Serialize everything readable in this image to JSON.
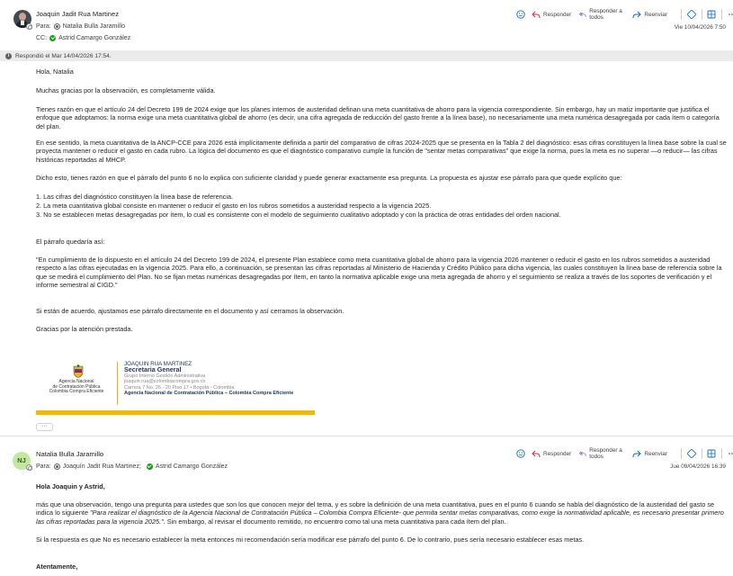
{
  "message1": {
    "sender": "Joaquin Jadit Rua Martinez",
    "to_label": "Para:",
    "to": "Natalia Bulla Jaramillo",
    "cc_label": "CC:",
    "cc": "Astrid Camargo González",
    "date": "Vie 10/04/2026 7:50",
    "toolbar": {
      "reply": "Responder",
      "reply_all": "Responder a todos",
      "forward": "Reenviar"
    },
    "replied_notice": "Respondió el Mar 14/04/2026 17:54.",
    "greeting": "Hola, Natalia",
    "p1": "Muchas gracias por la observación, es completamente válida.",
    "p2": "Tienes razón en que el artículo 24 del Decreto 199 de 2024 exige que los planes internos de austeridad definan una meta cuantitativa de ahorro para la vigencia correspondiente. Sin embargo, hay un matiz importante que justifica el enfoque que adoptamos: la norma exige una meta cuantitativa global de ahorro (es decir, una cifra agregada de reducción del gasto frente a la línea base), no necesariamente una meta numérica desagregada por cada ítem o categoría del plan.",
    "p3": "En ese sentido, la meta cuantitativa de la ANCP-CCE para 2026 está implícitamente definida a partir del comparativo de cifras 2024-2025 que se presenta en la Tabla 2 del diagnóstico: esas cifras constituyen la línea base sobre la cual se proyecta mantener o reducir el gasto en cada rubro. La lógica del documento es que el diagnóstico comparativo cumple la función de \"sentar metas comparativas\" que exige la norma, pues la meta es no superar —o reducir— las cifras históricas reportadas al MHCP.",
    "p4": "Dicho esto, tienes razón en que el párrafo del punto 6 no lo explica con suficiente claridad y puede generar exactamente esa pregunta. La propuesta es ajustar ese párrafo para que quede explícito que:",
    "list": [
      "1. Las cifras del diagnóstico constituyen la línea base de referencia.",
      "2. La meta cuantitativa global consiste en mantener o reducir el gasto en los rubros sometidos a austeridad respecto a la vigencia 2025.",
      "3. No se establecen metas desagregadas por ítem, lo cual es consistente con el modelo de seguimiento cualitativo adoptado y con la práctica de otras entidades del orden nacional."
    ],
    "p5": "El párrafo quedaría así:",
    "p6": "\"En cumplimiento de lo dispuesto en el artículo 24 del Decreto 199 de 2024, el presente Plan establece como meta cuantitativa global de ahorro para la vigencia 2026 mantener o reducir el gasto en los rubros sometidos a austeridad respecto a las cifras ejecutadas en la vigencia 2025. Para ello, a continuación, se presentan las cifras reportadas al Ministerio de Hacienda y Crédito Público para dicha vigencia, las cuales constituyen la línea base de referencia sobre la que se medirá el cumplimiento del Plan. No se fijan metas numéricas desagregadas por ítem, en tanto la normativa aplicable exige una meta agregada de ahorro y el seguimiento se realiza a través de los soportes de verificación y el informe semestral al CIGD.\"",
    "p7": "Si están de acuerdo, ajustamos ese párrafo directamente en el documento y así cerramos la observación.",
    "p8": "Gracias por la atención prestada.",
    "signature": {
      "org_line1": "Agencia Nacional",
      "org_line2": "de Contratación Pública",
      "org_line3": "Colombia Compra Eficiente",
      "name": "JOAQUIN RUA MARTINEZ",
      "role": "Secretaria General",
      "group": "Grupo Interno Gestión Administrativa",
      "email": "joaquin.rua@colombiacompra.gov.co",
      "address": "Carrera 7 No. 26 - 20 Piso 17 • Bogotá - Colombia",
      "agency": "Agencia Nacional de Contratación Pública – Colombia Compra Eficiente"
    },
    "more_button": "···"
  },
  "message2": {
    "initials": "NJ",
    "sender": "Natalia Bulla Jaramillo",
    "to_label": "Para:",
    "to1": "Joaquín Jadit Rua Martinez;",
    "to2": "Astrid Camargo González",
    "date": "Jue 09/04/2026 16:39",
    "toolbar": {
      "reply": "Responder",
      "reply_all": "Responder a todos",
      "forward": "Reenviar"
    },
    "greeting": "Hola Joaquin y Astrid,",
    "p1_a": "más que una observación, tengo una pregunta para ustedes que son los que conocen mejor del tema, y es sobre la definición de una meta cuantitativa,  pues en el punto 6 cuando se habla del diagnóstico de la austeridad del gasto se indica lo siguiente ",
    "p1_italic": "\"Para realizar el diagnóstico de la Agencia Nacional de Contratación Pública – Colombia Compra Eficiente- que permita sentar metas comparativas, como exige la normatividad aplicable, es necesario presentar primero las cifras reportadas para la vigencia 2025.\"",
    "p1_b": ".  Sin embargo, al revisar el documento remitido, no encuentro como tal una meta cuantitativa para cada ítem del plan.",
    "p2": "Si la respuesta es que No es necesario establecer la meta entonces mi recomendación sería modificar ese párrafo del punto 6. De lo contrario, pues sería necesario establecer esas metas.",
    "closing": "Atentamente,"
  },
  "colors": {
    "accent": "#0f6cbd",
    "presence_green": "#13a10e",
    "signature_bar": "#f5b800",
    "avatar_nj_bg": "#c3e6a0"
  },
  "icons": [
    "emoji-icon",
    "reply-icon",
    "reply-all-icon",
    "forward-icon",
    "teams-icon",
    "grid-icon",
    "more-icon",
    "info-icon"
  ]
}
